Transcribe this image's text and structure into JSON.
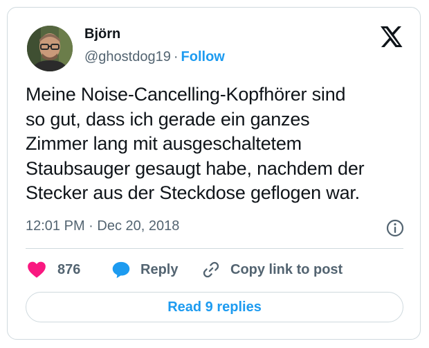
{
  "author": {
    "name": "Björn",
    "handle": "@ghostdog19",
    "separator": "·",
    "follow_label": "Follow"
  },
  "tweet": {
    "lines": [
      "Meine Noise-Cancelling-Kopfhörer sind",
      "so gut, dass ich gerade ein ganzes",
      "Zimmer lang mit ausgeschaltetem",
      "Staubsauger gesaugt habe, nachdem der",
      "Stecker aus der Steckdose geflogen war."
    ],
    "timestamp": "12:01 PM · Dec 20, 2018"
  },
  "actions": {
    "like_count": "876",
    "reply_label": "Reply",
    "copy_label": "Copy link to post"
  },
  "read_replies_label": "Read 9 replies",
  "icons": {
    "platform": "x-logo-icon",
    "info": "info-icon",
    "like": "heart-icon",
    "reply": "speech-bubble-icon",
    "copy": "link-icon"
  },
  "colors": {
    "accent": "#1d9bf0",
    "like": "#f91880",
    "text": "#0f1419",
    "muted": "#536471",
    "border": "#cfd9de"
  }
}
